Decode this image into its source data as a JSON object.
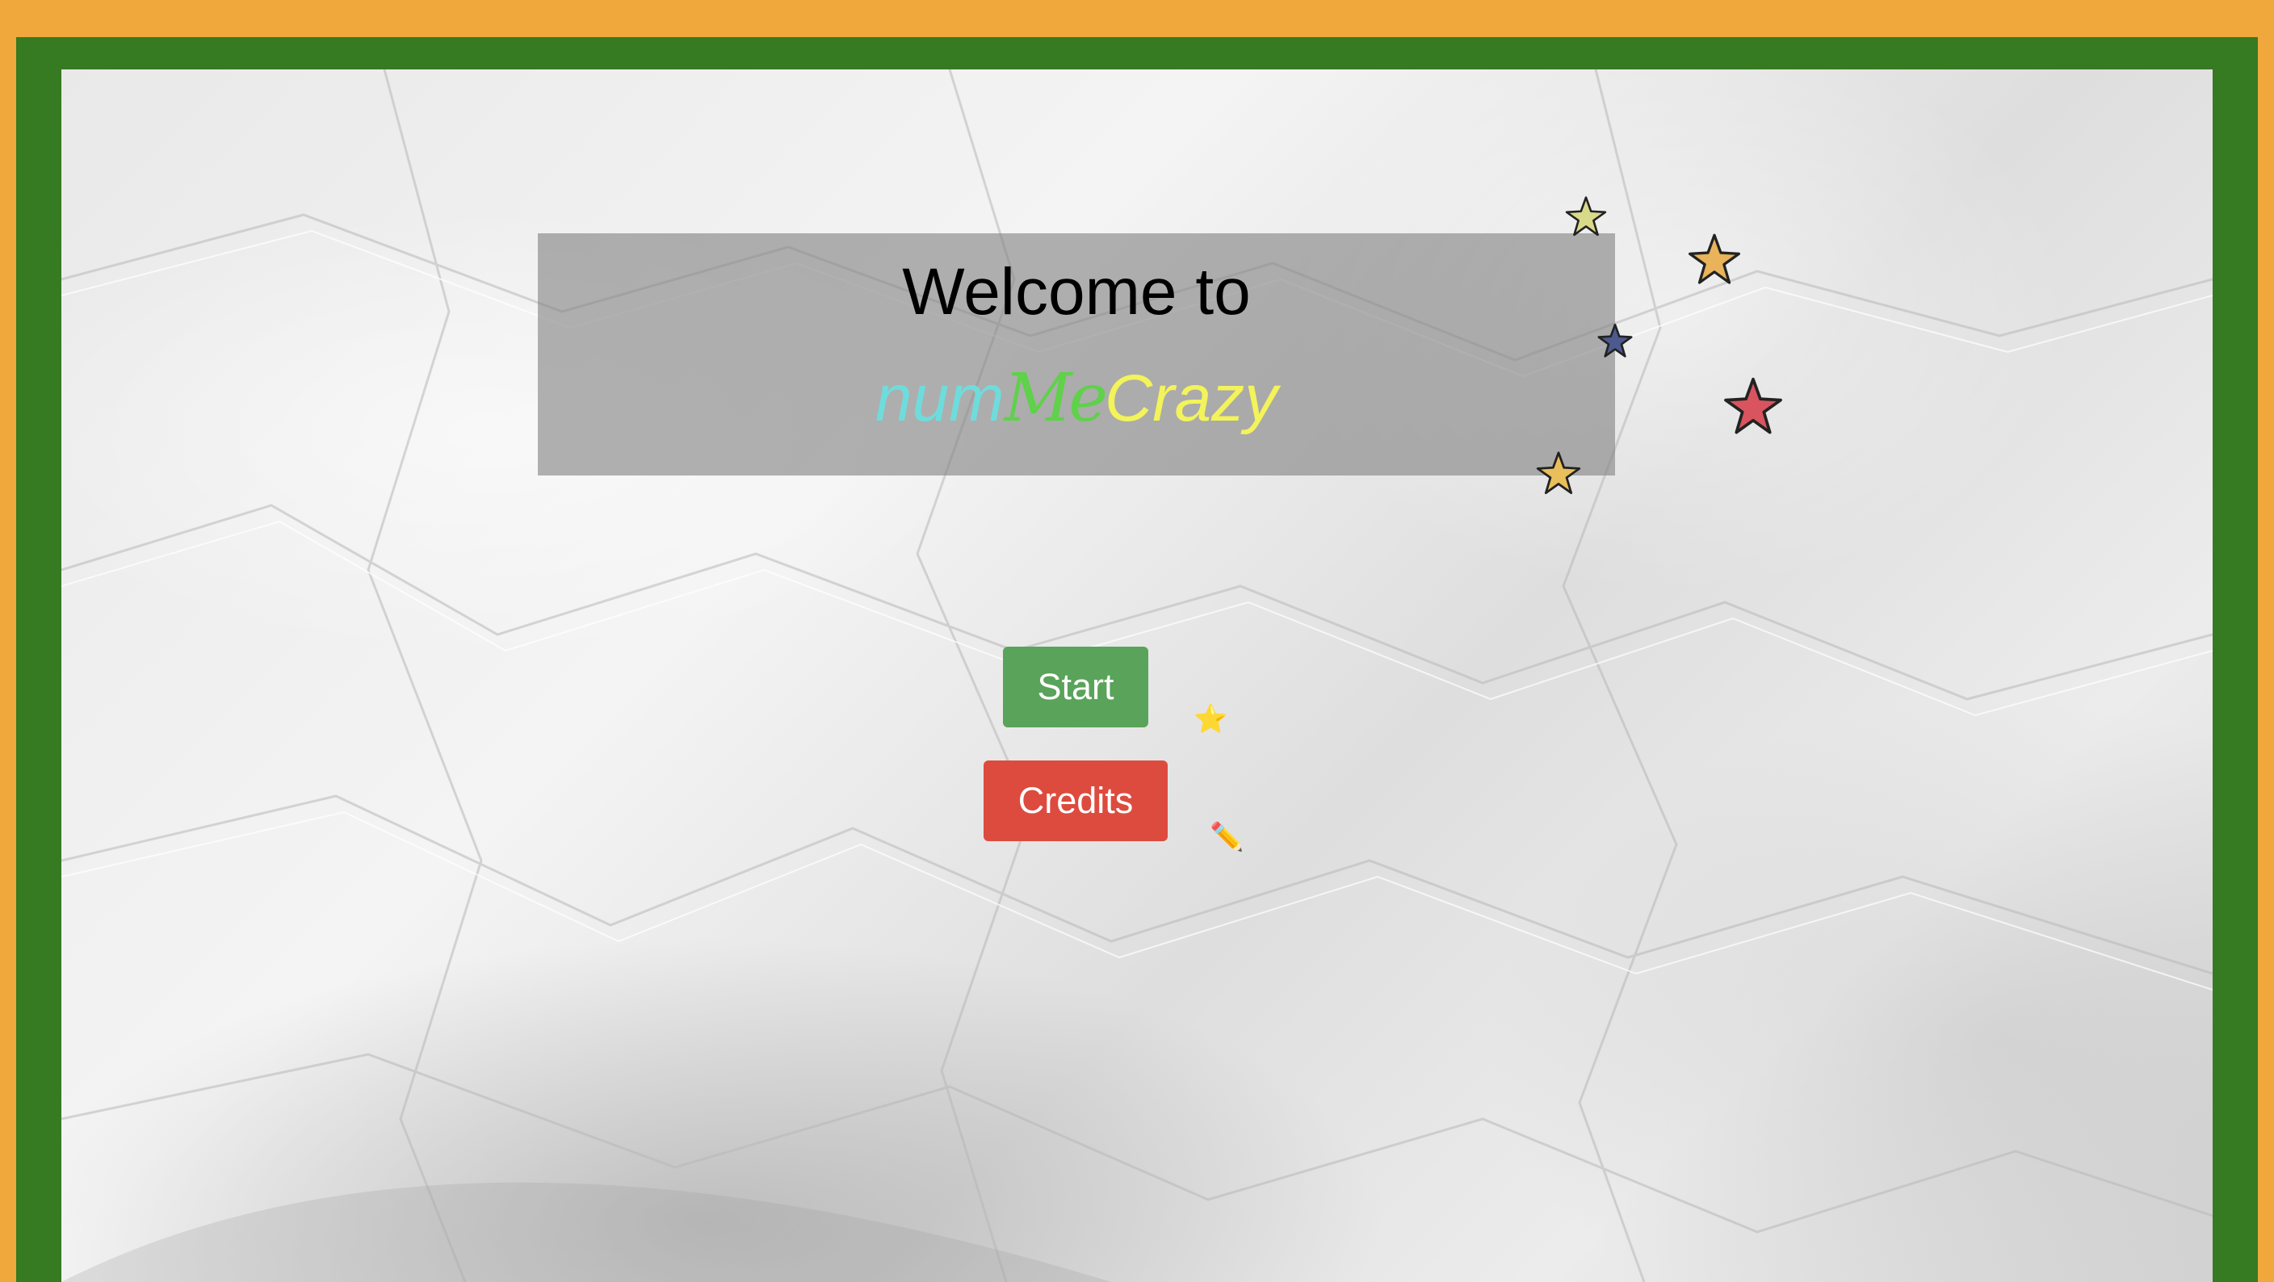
{
  "banner": {
    "welcome": "Welcome to",
    "brand_part1": "num",
    "brand_part2": "Me",
    "brand_part3": "Crazy"
  },
  "buttons": {
    "start_label": "Start",
    "credits_label": "Credits"
  },
  "decorations": {
    "start_emoji": "⭐",
    "credits_emoji": "✏️"
  },
  "colors": {
    "outer_border": "#f0a83c",
    "inner_border": "#367a22",
    "start_button": "#5aa35a",
    "credits_button": "#dd4b3e",
    "brand_num": "#6fdcdc",
    "brand_me": "#5fd14a",
    "brand_crazy": "#f3f35a"
  },
  "stars": [
    {
      "icon": "star-icon",
      "color": "#d9d98a"
    },
    {
      "icon": "star-icon",
      "color": "#e8b35a"
    },
    {
      "icon": "star-icon",
      "color": "#4c5a8f"
    },
    {
      "icon": "star-icon",
      "color": "#d9545e"
    },
    {
      "icon": "star-icon",
      "color": "#e8bf5a"
    }
  ]
}
